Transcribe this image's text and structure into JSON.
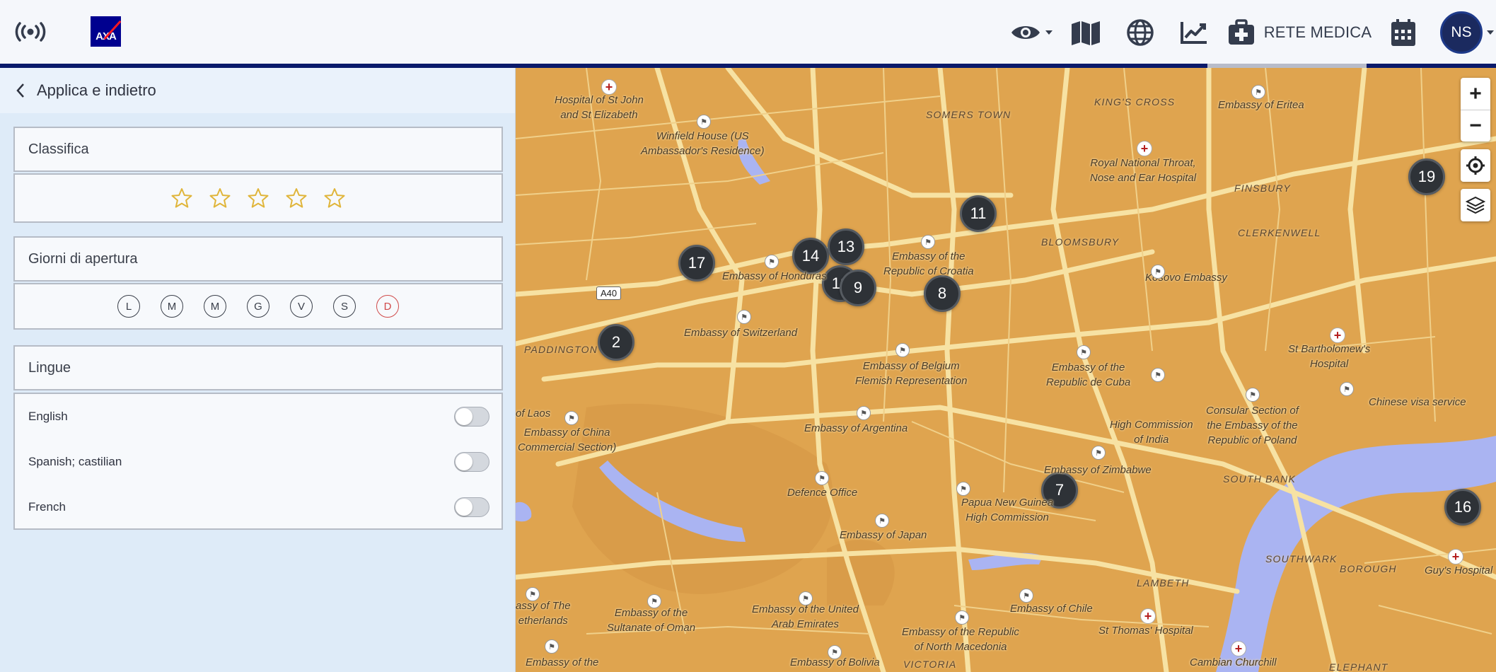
{
  "header": {
    "rete_label": "RETE MEDICA",
    "avatar_initials": "NS",
    "logo_text": "AXA"
  },
  "sidebar": {
    "back_label": "Applica e indietro",
    "rating": {
      "title": "Classifica",
      "stars": 5
    },
    "opening_days": {
      "title": "Giorni di apertura",
      "days": [
        "L",
        "M",
        "M",
        "G",
        "V",
        "S",
        "D"
      ]
    },
    "languages": {
      "title": "Lingue",
      "items": [
        {
          "name": "English",
          "enabled": false
        },
        {
          "name": "Spanish; castilian",
          "enabled": false
        },
        {
          "name": "French",
          "enabled": false
        }
      ]
    }
  },
  "map": {
    "road_badge": "A40",
    "clusters": [
      "17",
      "14",
      "13",
      "12",
      "9",
      "8",
      "11",
      "2",
      "7",
      "19",
      "16"
    ],
    "areas": [
      "KING'S CROSS",
      "SOMERS TOWN",
      "BLOOMSBURY",
      "FINSBURY",
      "CLERKENWELL",
      "PADDINGTON",
      "SOUTH BANK",
      "SOUTHWARK",
      "LAMBETH",
      "BOROUGH",
      "VICTORIA",
      "ELEPHANT"
    ],
    "places": [
      "Hospital of St John\nand St Elizabeth",
      "Winfield House (US\nAmbassador's Residence)",
      "Embassy of Eritea",
      "Royal National Throat,\nNose and Ear Hospital",
      "Embassy of Honduras",
      "Embassy of the\nRepublic of Croatia",
      "Kosovo Embassy",
      "Embassy of Switzerland",
      "Embassy of Belgium\nFlemish Representation",
      "Embassy of the\nRepublic de Cuba",
      "St Bartholomew's\nHospital",
      "Chinese visa service",
      "of Laos",
      "Embassy of China\nCommercial Section)",
      "Embassy of Argentina",
      "High Commission\nof India",
      "Consular Section of\nthe Embassy of the\nRepublic of Poland",
      "Embassy of Zimbabwe",
      "Defence Office",
      "Papua New Guinea\nHigh Commission",
      "Embassy of Japan",
      "assy of The\netherlands",
      "Embassy of the\nSultanate of Oman",
      "Embassy of the United\nArab Emirates",
      "Embassy of Chile",
      "Embassy of the Republic\nof North Macedonia",
      "St Thomas' Hospital",
      "Guy's Hospital",
      "Embassy of Bolivia",
      "Cambian Churchill",
      "Embassy of the"
    ]
  }
}
